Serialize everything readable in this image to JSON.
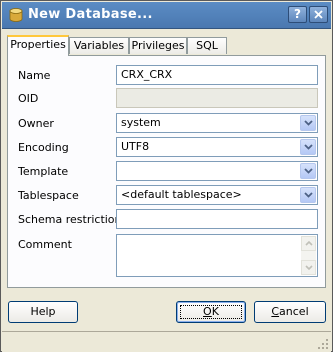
{
  "window": {
    "title": "New Database..."
  },
  "tabs": [
    {
      "label": "Properties"
    },
    {
      "label": "Variables"
    },
    {
      "label": "Privileges"
    },
    {
      "label": "SQL"
    }
  ],
  "form": {
    "name": {
      "label": "Name",
      "value": "CRX_CRX"
    },
    "oid": {
      "label": "OID",
      "value": ""
    },
    "owner": {
      "label": "Owner",
      "value": "system"
    },
    "encoding": {
      "label": "Encoding",
      "value": "UTF8"
    },
    "template": {
      "label": "Template",
      "value": ""
    },
    "tablespace": {
      "label": "Tablespace",
      "value": "<default tablespace>"
    },
    "schema_restriction": {
      "label": "Schema restriction",
      "value": ""
    },
    "comment": {
      "label": "Comment",
      "value": ""
    }
  },
  "buttons": {
    "help": "Help",
    "ok_mnemonic": "O",
    "ok_rest": "K",
    "cancel_mnemonic": "C",
    "cancel_rest": "ancel"
  },
  "colors": {
    "titlebar": "#4f80bb",
    "active_tab_highlight": "#ffc83c",
    "dialog_bg": "#ece9d8"
  }
}
